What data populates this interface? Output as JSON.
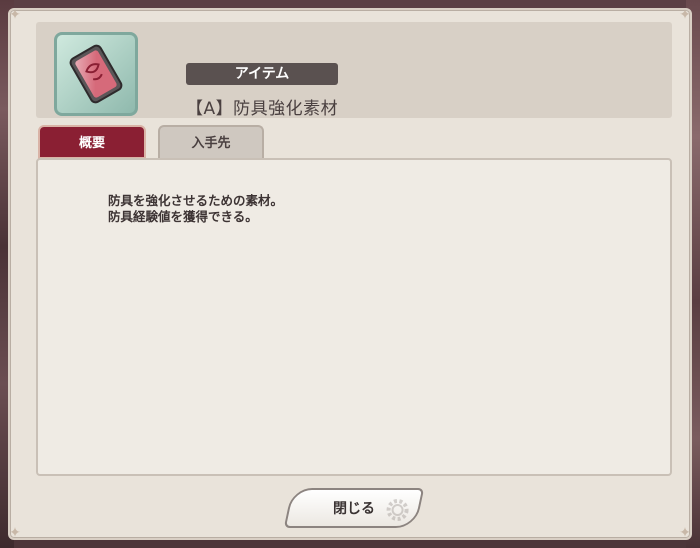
{
  "dialog": {
    "item_type_badge": "アイテム",
    "item_name": "【A】防具強化素材",
    "item_icon": "armor-enhancement-material-icon"
  },
  "tabs": [
    {
      "label": "概要",
      "active": true
    },
    {
      "label": "入手先",
      "active": false
    }
  ],
  "description": {
    "lines": [
      "防具を強化させるための素材。",
      "防具経験値を獲得できる。"
    ]
  },
  "footer": {
    "close_label": "閉じる"
  },
  "colors": {
    "active_tab": "#8a1f33",
    "badge": "#5a5150",
    "icon_frame": "#8fb9ad"
  }
}
